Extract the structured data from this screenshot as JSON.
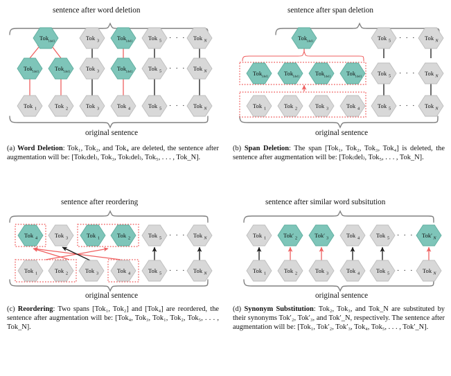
{
  "figure": {
    "type": "diagram",
    "description": "Four sub-diagrams illustrating text data augmentation operations on a token sequence",
    "colors": {
      "teal_fill": "#7ec5b9",
      "teal_stroke": "#5fae9f",
      "gray_fill": "#d8d8d8",
      "gray_stroke": "#bdbdbd",
      "red_arrow": "#ef5f5f",
      "red_dotted": "#ee4b4b",
      "black_arrow": "#1a1a1a",
      "brace_gray": "#808080",
      "text": "#111111"
    },
    "labels": {
      "original_sentence": "original sentence",
      "ellipsis": "· · ·"
    }
  },
  "subfigures": [
    {
      "id": "a",
      "key": "word-deletion",
      "top_title": "sentence after word deletion",
      "bottom_title": "original sentence",
      "rows": {
        "bottom": [
          {
            "label": "Tok",
            "sub": "1",
            "color": "gray"
          },
          {
            "label": "Tok",
            "sub": "2",
            "color": "gray"
          },
          {
            "label": "Tok",
            "sub": "3",
            "color": "gray"
          },
          {
            "label": "Tok",
            "sub": "4",
            "color": "gray"
          },
          {
            "label": "Tok",
            "sub": "5",
            "color": "gray"
          },
          {
            "label": "…",
            "sub": "",
            "color": "ellipsis"
          },
          {
            "label": "Tok",
            "sub": "N",
            "color": "gray"
          }
        ],
        "middle": [
          {
            "label": "Tok",
            "sub": "[del]",
            "color": "teal"
          },
          {
            "label": "Tok",
            "sub": "[del]",
            "color": "teal"
          },
          {
            "label": "Tok",
            "sub": "3",
            "color": "gray"
          },
          {
            "label": "Tok",
            "sub": "[del]",
            "color": "teal"
          },
          {
            "label": "Tok",
            "sub": "5",
            "color": "gray"
          },
          {
            "label": "…",
            "sub": "",
            "color": "ellipsis"
          },
          {
            "label": "Tok",
            "sub": "N",
            "color": "gray"
          }
        ],
        "top": [
          {
            "label": "Tok",
            "sub": "[del]",
            "color": "teal"
          },
          {
            "label": "Tok",
            "sub": "3",
            "color": "gray"
          },
          {
            "label": "Tok",
            "sub": "[del]",
            "color": "teal"
          },
          {
            "label": "Tok",
            "sub": "5",
            "color": "gray"
          },
          {
            "label": "…",
            "sub": "",
            "color": "ellipsis"
          },
          {
            "label": "Tok",
            "sub": "N",
            "color": "gray"
          }
        ]
      },
      "caption_prefix": "(a)",
      "caption_title": "Word Deletion",
      "caption_body": ": Tok₁, Tok₂, and Tok₄ are deleted, the sentence after augmentation will be: [Tok₍del₎, Tok₃, Tok₍del₎, Tok₅, . . . , Tok_N]."
    },
    {
      "id": "b",
      "key": "span-deletion",
      "top_title": "sentence after span deletion",
      "bottom_title": "original sentence",
      "rows": {
        "bottom": [
          {
            "label": "Tok",
            "sub": "1",
            "color": "gray"
          },
          {
            "label": "Tok",
            "sub": "2",
            "color": "gray"
          },
          {
            "label": "Tok",
            "sub": "3",
            "color": "gray"
          },
          {
            "label": "Tok",
            "sub": "4",
            "color": "gray"
          },
          {
            "label": "Tok",
            "sub": "5",
            "color": "gray"
          },
          {
            "label": "…",
            "sub": "",
            "color": "ellipsis"
          },
          {
            "label": "Tok",
            "sub": "N",
            "color": "gray"
          }
        ],
        "middle": [
          {
            "label": "Tok",
            "sub": "[del]",
            "color": "teal"
          },
          {
            "label": "Tok",
            "sub": "[del]",
            "color": "teal"
          },
          {
            "label": "Tok",
            "sub": "[del]",
            "color": "teal"
          },
          {
            "label": "Tok",
            "sub": "[del]",
            "color": "teal"
          },
          {
            "label": "Tok",
            "sub": "5",
            "color": "gray"
          },
          {
            "label": "…",
            "sub": "",
            "color": "ellipsis"
          },
          {
            "label": "Tok",
            "sub": "N",
            "color": "gray"
          }
        ],
        "top": [
          {
            "label": "Tok",
            "sub": "[del]",
            "color": "teal"
          },
          {
            "label": "Tok",
            "sub": "5",
            "color": "gray"
          },
          {
            "label": "…",
            "sub": "",
            "color": "ellipsis"
          },
          {
            "label": "Tok",
            "sub": "N",
            "color": "gray"
          }
        ]
      },
      "caption_prefix": "(b)",
      "caption_title": "Span Deletion",
      "caption_body": ": The span [Tok₁, Tok₂, Tok₃, Tok₄] is deleted, the sentence after augmentation will be: [Tok₍del₎, Tok₅, . . . , Tok_N]."
    },
    {
      "id": "c",
      "key": "reordering",
      "top_title": "sentence after reordering",
      "bottom_title": "original sentence",
      "rows": {
        "bottom": [
          {
            "label": "Tok",
            "sub": "1",
            "color": "gray"
          },
          {
            "label": "Tok",
            "sub": "2",
            "color": "gray"
          },
          {
            "label": "Tok",
            "sub": "3",
            "color": "gray"
          },
          {
            "label": "Tok",
            "sub": "4",
            "color": "gray"
          },
          {
            "label": "Tok",
            "sub": "5",
            "color": "gray"
          },
          {
            "label": "…",
            "sub": "",
            "color": "ellipsis"
          },
          {
            "label": "Tok",
            "sub": "N",
            "color": "gray"
          }
        ],
        "top": [
          {
            "label": "Tok",
            "sub": "4",
            "color": "teal"
          },
          {
            "label": "Tok",
            "sub": "3",
            "color": "gray"
          },
          {
            "label": "Tok",
            "sub": "1",
            "color": "teal"
          },
          {
            "label": "Tok",
            "sub": "2",
            "color": "teal"
          },
          {
            "label": "Tok",
            "sub": "5",
            "color": "gray"
          },
          {
            "label": "…",
            "sub": "",
            "color": "ellipsis"
          },
          {
            "label": "Tok",
            "sub": "N",
            "color": "gray"
          }
        ]
      },
      "caption_prefix": "(c)",
      "caption_title": "Reordering",
      "caption_body": ": Two spans [Tok₁, Tok₂] and [Tok₄] are reordered, the sentence after augmentation will be: [Tok₄, Tok₃, Tok₁, Tok₂, Tok₅, . . . , Tok_N]."
    },
    {
      "id": "d",
      "key": "synonym-substitution",
      "top_title": "sentence after similar word subsitution",
      "bottom_title": "original sentence",
      "rows": {
        "bottom": [
          {
            "label": "Tok",
            "sub": "1",
            "color": "gray"
          },
          {
            "label": "Tok",
            "sub": "2",
            "color": "gray"
          },
          {
            "label": "Tok",
            "sub": "3",
            "color": "gray"
          },
          {
            "label": "Tok",
            "sub": "4",
            "color": "gray"
          },
          {
            "label": "Tok",
            "sub": "5",
            "color": "gray"
          },
          {
            "label": "…",
            "sub": "",
            "color": "ellipsis"
          },
          {
            "label": "Tok",
            "sub": "N",
            "color": "gray"
          }
        ],
        "top": [
          {
            "label": "Tok",
            "sub": "1",
            "color": "gray"
          },
          {
            "label": "Tok′",
            "sub": "2",
            "color": "teal"
          },
          {
            "label": "Tok′",
            "sub": "3",
            "color": "teal"
          },
          {
            "label": "Tok",
            "sub": "4",
            "color": "gray"
          },
          {
            "label": "Tok",
            "sub": "5",
            "color": "gray"
          },
          {
            "label": "…",
            "sub": "",
            "color": "ellipsis"
          },
          {
            "label": "Tok′",
            "sub": "N",
            "color": "teal"
          }
        ]
      },
      "caption_prefix": "(d)",
      "caption_title": "Synonym Substitution",
      "caption_body": ": Tok₂, Tok₃, and Tok_N are substituted by their synonyms Tok′₂, Tok′₃, and Tok′_N, respectively. The sentence after augmentation will be: [Tok₁, Tok′₂, Tok′₃, Tok₄, Tok₅, . . . , Tok′_N]."
    }
  ]
}
